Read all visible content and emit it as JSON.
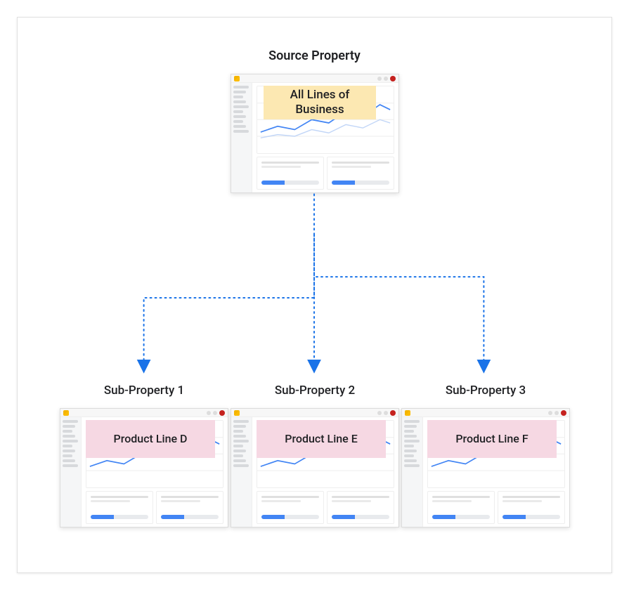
{
  "source": {
    "title": "Source Property",
    "overlay_label": "All Lines of Business"
  },
  "subs": [
    {
      "title": "Sub-Property 1",
      "overlay_label": "Product Line D"
    },
    {
      "title": "Sub-Property 2",
      "overlay_label": "Product Line E"
    },
    {
      "title": "Sub-Property 3",
      "overlay_label": "Product Line F"
    }
  ],
  "connectors": {
    "color": "#1a73e8"
  }
}
